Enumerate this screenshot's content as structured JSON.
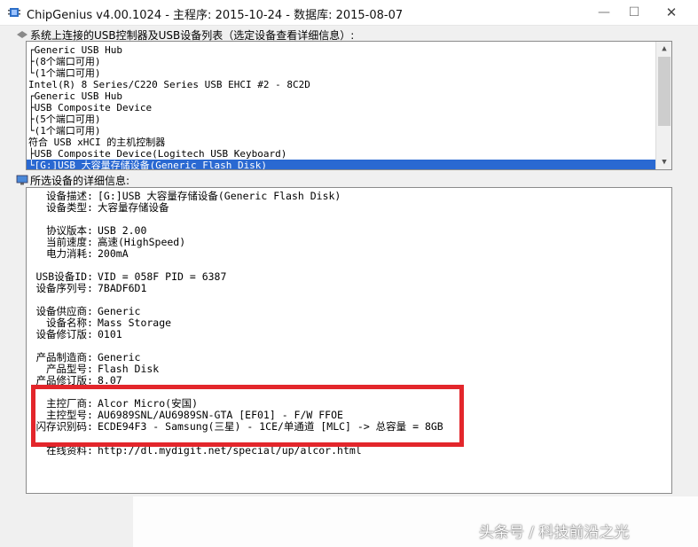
{
  "window": {
    "title": "ChipGenius v4.00.1024 - 主程序: 2015-10-24 - 数据库: 2015-08-07",
    "minimize": "—",
    "maximize": "☐",
    "close": "✕"
  },
  "device_list": {
    "label": "系统上连接的USB控制器及USB设备列表（选定设备查看详细信息）:",
    "rows": [
      "┌Generic USB Hub",
      "  ├(8个端口可用)",
      "  └(1个端口可用)",
      "Intel(R) 8 Series/C220 Series USB EHCI #2 - 8C2D",
      "  ┌Generic USB Hub",
      "  ├USB Composite Device",
      "  ├(5个端口可用)",
      "  └(1个端口可用)",
      "符合 USB xHCI 的主机控制器",
      "  ├USB Composite Device(Logitech USB Keyboard)",
      "  └[G:]USB 大容量存储设备(Generic Flash Disk)"
    ],
    "selected_index": 10,
    "scroll_up": "▲",
    "scroll_down": "▼"
  },
  "details": {
    "label": "所选设备的详细信息:",
    "rows": [
      {
        "label": "设备描述:",
        "value": "[G:]USB 大容量存储设备(Generic Flash Disk)"
      },
      {
        "label": "设备类型:",
        "value": "大容量存储设备"
      },
      {
        "label": "协议版本:",
        "value": "USB 2.00"
      },
      {
        "label": "当前速度:",
        "value": "高速(HighSpeed)"
      },
      {
        "label": "电力消耗:",
        "value": "200mA"
      },
      {
        "label": "USB设备ID:",
        "value": "VID = 058F PID = 6387"
      },
      {
        "label": "设备序列号:",
        "value": "7BADF6D1"
      },
      {
        "label": "设备供应商:",
        "value": "Generic"
      },
      {
        "label": "设备名称:",
        "value": "Mass Storage"
      },
      {
        "label": "设备修订版:",
        "value": "0101"
      },
      {
        "label": "产品制造商:",
        "value": "Generic"
      },
      {
        "label": "产品型号:",
        "value": "Flash Disk"
      },
      {
        "label": "产品修订版:",
        "value": "8.07"
      },
      {
        "label": "主控厂商:",
        "value": "Alcor Micro(安国)"
      },
      {
        "label": "主控型号:",
        "value": "AU6989SNL/AU6989SN-GTA [EF01] - F/W FFOE"
      },
      {
        "label": "闪存识别码:",
        "value": "ECDE94F3 - Samsung(三星) - 1CE/单通道 [MLC] -> 总容量 = 8GB"
      },
      {
        "label": "在线资料:",
        "value": "http://dl.mydigit.net/special/up/alcor.html"
      }
    ]
  },
  "watermark": "头条号 / 科技前沿之光"
}
